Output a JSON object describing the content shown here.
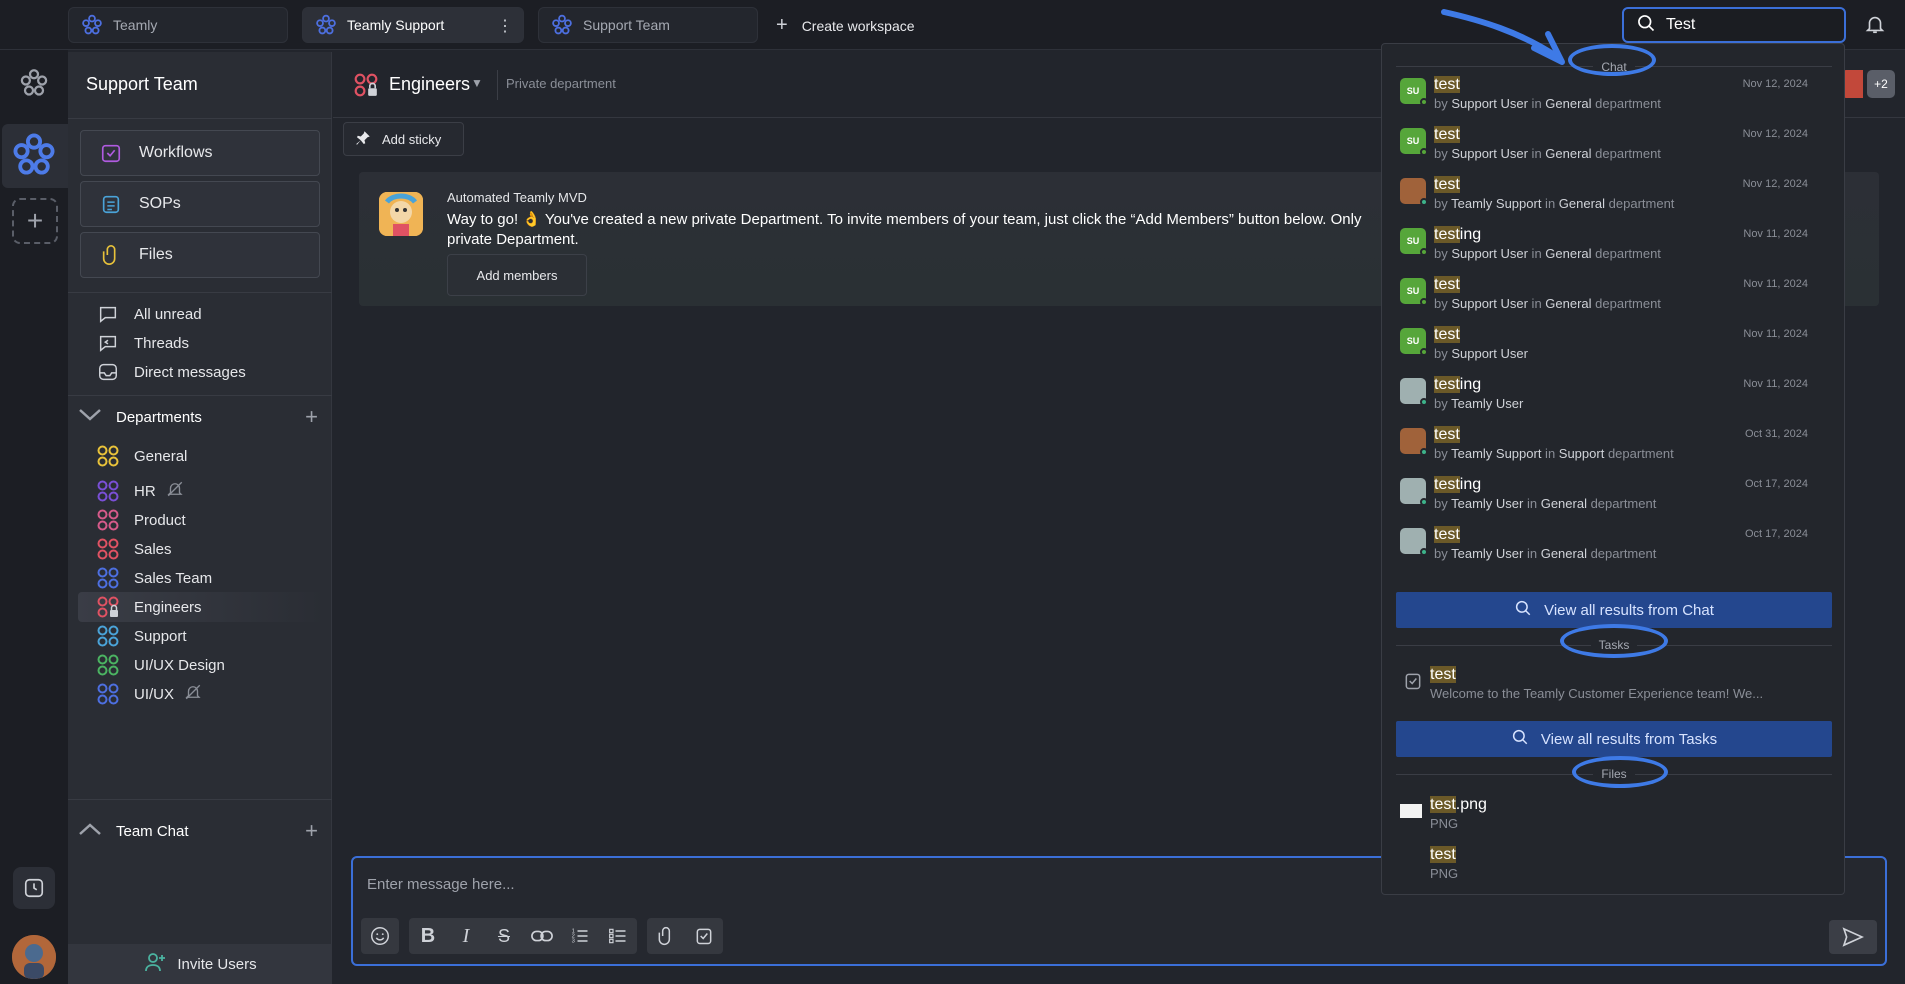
{
  "topbar": {
    "tabs": [
      {
        "label": "Teamly"
      },
      {
        "label": "Teamly Support"
      },
      {
        "label": "Support Team"
      }
    ],
    "create_workspace": "Create workspace",
    "search_value": "Test"
  },
  "sidebar": {
    "title": "Support Team",
    "big_buttons": [
      {
        "label": "Workflows",
        "icon": "workflows-icon"
      },
      {
        "label": "SOPs",
        "icon": "sops-icon"
      },
      {
        "label": "Files",
        "icon": "paperclip-icon"
      }
    ],
    "nav": [
      {
        "label": "All unread"
      },
      {
        "label": "Threads"
      },
      {
        "label": "Direct messages"
      }
    ],
    "departments_label": "Departments",
    "departments": [
      {
        "label": "General",
        "color": "#e8c23a"
      },
      {
        "label": "HR",
        "color": "#7a4fd6"
      },
      {
        "label": "Product",
        "color": "#d65a8a"
      },
      {
        "label": "Sales",
        "color": "#e05263"
      },
      {
        "label": "Sales Team",
        "color": "#4d6fe0"
      },
      {
        "label": "Engineers",
        "color": "#e05263"
      },
      {
        "label": "Support",
        "color": "#4aa3d8"
      },
      {
        "label": "UI/UX Design",
        "color": "#4bb362"
      },
      {
        "label": "UI/UX",
        "color": "#4d6fe0"
      }
    ],
    "team_chat_label": "Team Chat",
    "invite_label": "Invite Users"
  },
  "channel": {
    "name": "Engineers",
    "type": "Private department",
    "extra_members": "+2",
    "add_sticky": "Add sticky",
    "bot_name": "Automated Teamly MVD",
    "bot_text": "Way to go! 👌 You've created a new private Department. To invite members of your team, just click the “Add Members” button below. Only private Department.",
    "add_members": "Add members",
    "composer_placeholder": "Enter message here..."
  },
  "search": {
    "chat_label": "Chat",
    "tasks_label": "Tasks",
    "files_label": "Files",
    "chat_results": [
      {
        "match": "test",
        "rest": "",
        "by": "by ",
        "user": "Support User",
        "in": " in ",
        "dept": "General",
        "tail": " department",
        "date": "Nov 12, 2024",
        "av": "SU",
        "avcolor": "#56a63a"
      },
      {
        "match": "test",
        "rest": "",
        "by": "by ",
        "user": "Support User",
        "in": " in ",
        "dept": "General",
        "tail": " department",
        "date": "Nov 12, 2024",
        "av": "SU",
        "avcolor": "#56a63a"
      },
      {
        "match": "test",
        "rest": "",
        "by": "by ",
        "user": "Teamly Support",
        "in": " in ",
        "dept": "General",
        "tail": " department",
        "date": "Nov 12, 2024",
        "av": "",
        "avcolor": "#a0623a"
      },
      {
        "match": "test",
        "rest": "ing",
        "by": "by ",
        "user": "Support User",
        "in": " in ",
        "dept": "General",
        "tail": " department",
        "date": "Nov 11, 2024",
        "av": "SU",
        "avcolor": "#56a63a"
      },
      {
        "match": "test",
        "rest": "",
        "by": "by ",
        "user": "Support User",
        "in": " in ",
        "dept": "General",
        "tail": " department",
        "date": "Nov 11, 2024",
        "av": "SU",
        "avcolor": "#56a63a"
      },
      {
        "match": "test",
        "rest": "",
        "by": "by ",
        "user": "Support User",
        "in": "",
        "dept": "",
        "tail": "",
        "date": "Nov 11, 2024",
        "av": "SU",
        "avcolor": "#56a63a"
      },
      {
        "match": "test",
        "rest": "ing",
        "by": "by ",
        "user": "Teamly User",
        "in": "",
        "dept": "",
        "tail": "",
        "date": "Nov 11, 2024",
        "av": "",
        "avcolor": "#9fb0b0"
      },
      {
        "match": "test",
        "rest": "",
        "by": "by ",
        "user": "Teamly Support",
        "in": " in ",
        "dept": "Support",
        "tail": " department",
        "date": "Oct 31, 2024",
        "av": "",
        "avcolor": "#a0623a"
      },
      {
        "match": "test",
        "rest": "ing",
        "by": "by ",
        "user": "Teamly User",
        "in": " in ",
        "dept": "General",
        "tail": " department",
        "date": "Oct 17, 2024",
        "av": "",
        "avcolor": "#9fb0b0"
      },
      {
        "match": "test",
        "rest": "",
        "by": "by ",
        "user": "Teamly User",
        "in": " in ",
        "dept": "General",
        "tail": " department",
        "date": "Oct 17, 2024",
        "av": "",
        "avcolor": "#9fb0b0"
      }
    ],
    "view_all_chat": "View all results from Chat",
    "task_result": {
      "match": "test",
      "sub": "Welcome to the Teamly Customer Experience team! We..."
    },
    "view_all_tasks": "View all results from Tasks",
    "file_results": [
      {
        "match": "test",
        "rest": ".png",
        "sub": "PNG"
      },
      {
        "match": "test",
        "rest": "",
        "sub": "PNG"
      }
    ]
  },
  "colors": {
    "accent": "#3b6fd8",
    "highlight": "#6b5928",
    "view_all_bg": "#24478e"
  }
}
